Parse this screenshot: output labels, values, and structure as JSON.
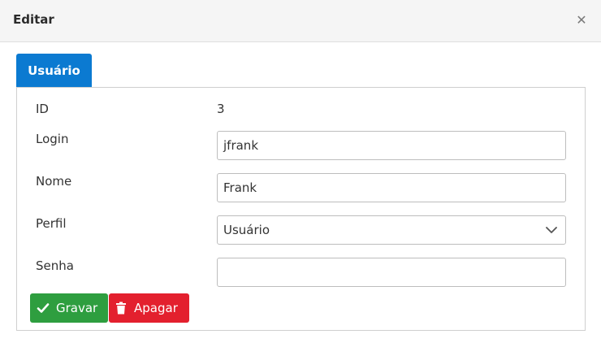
{
  "modal": {
    "title": "Editar",
    "close_icon": "close-icon"
  },
  "tabs": [
    {
      "label": "Usuário",
      "active": true
    }
  ],
  "form": {
    "id_label": "ID",
    "id_value": "3",
    "login_label": "Login",
    "login_value": "jfrank",
    "nome_label": "Nome",
    "nome_value": "Frank",
    "perfil_label": "Perfil",
    "perfil_value": "Usuário",
    "senha_label": "Senha",
    "senha_value": ""
  },
  "actions": {
    "save_label": "Gravar",
    "save_icon": "check-icon",
    "delete_label": "Apagar",
    "delete_icon": "trash-icon"
  },
  "colors": {
    "tab_active": "#0b7ad1",
    "save": "#2e9e3f",
    "delete": "#e3202e"
  }
}
